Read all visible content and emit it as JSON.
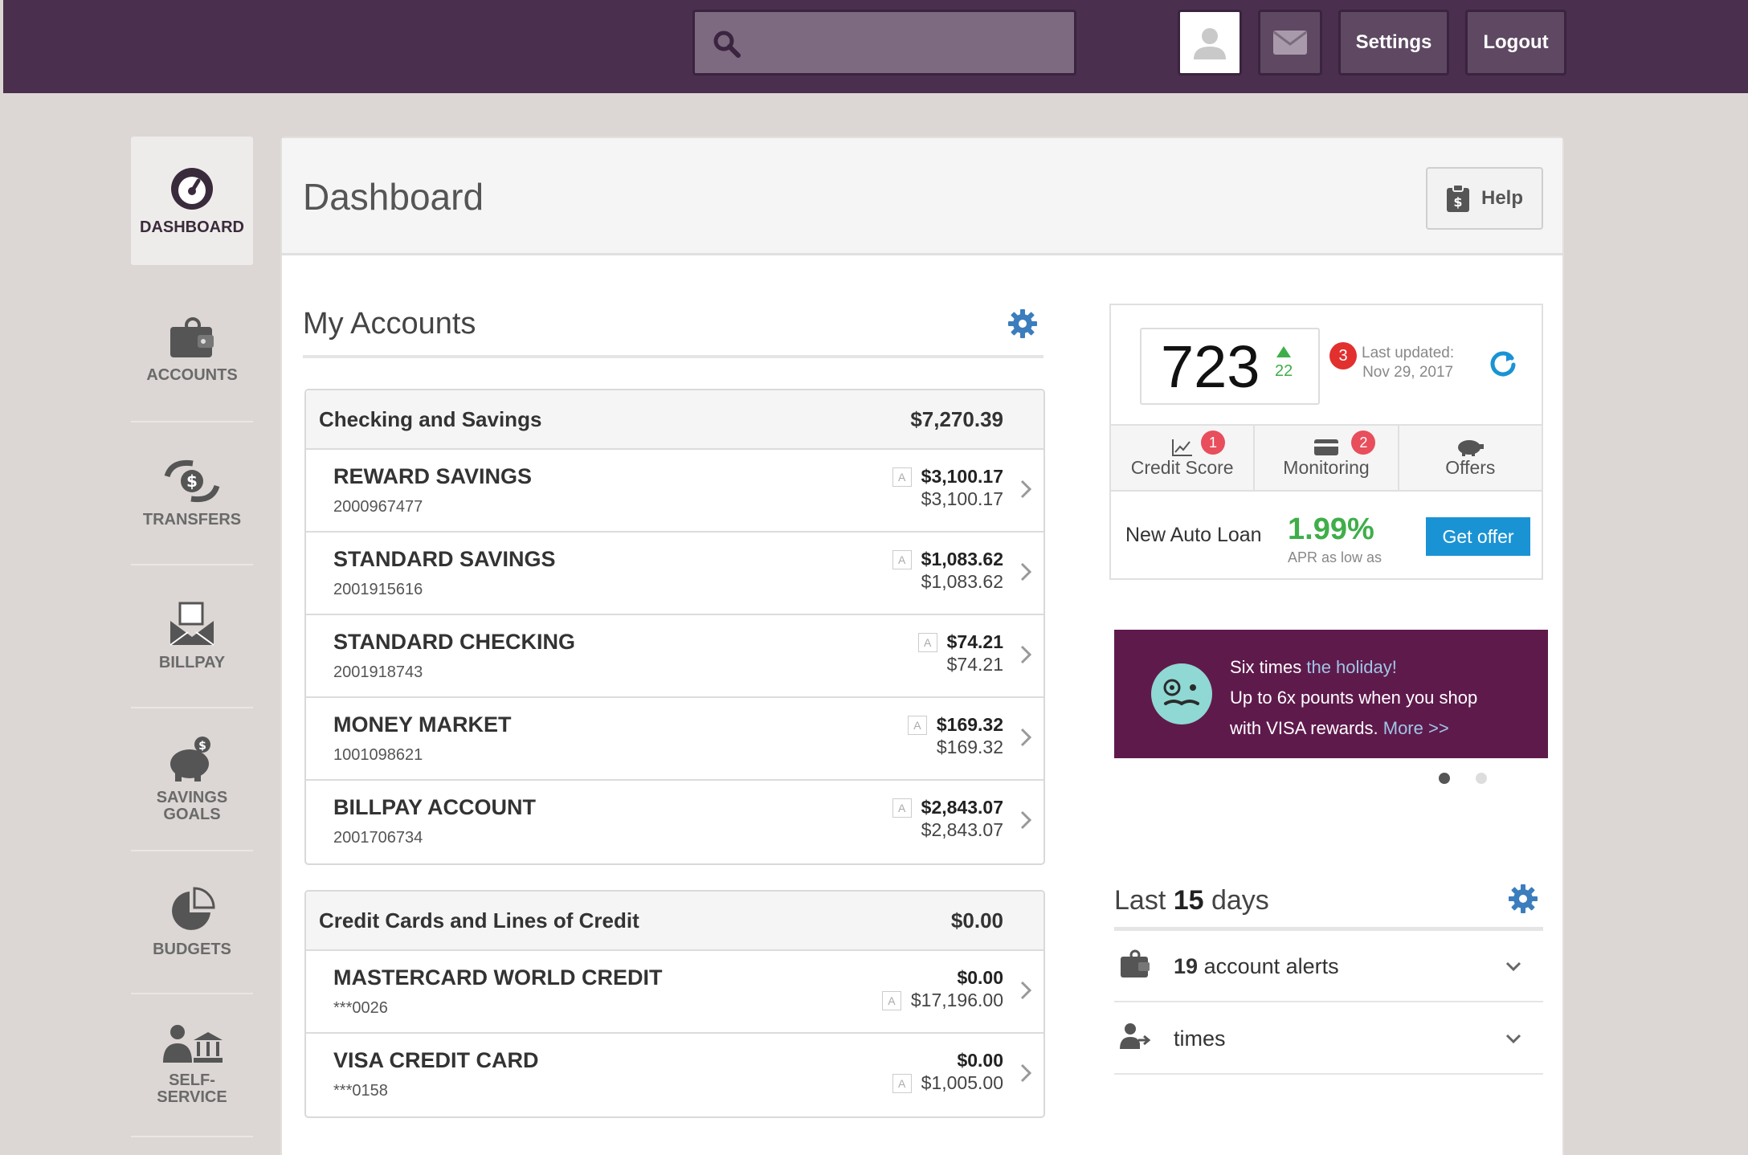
{
  "topbar": {
    "settings_label": "Settings",
    "logout_label": "Logout",
    "search_placeholder": ""
  },
  "sidebar": {
    "items": [
      {
        "label": "DASHBOARD"
      },
      {
        "label": "ACCOUNTS"
      },
      {
        "label": "TRANSFERS"
      },
      {
        "label": "BILLPAY"
      },
      {
        "label": "SAVINGS GOALS"
      },
      {
        "label": "BUDGETS"
      },
      {
        "label": "SELF-SERVICE"
      }
    ]
  },
  "header": {
    "title": "Dashboard",
    "help_label": "Help"
  },
  "accounts": {
    "title": "My Accounts",
    "groups": [
      {
        "name": "Checking and Savings",
        "total": "$7,270.39",
        "rows": [
          {
            "name": "REWARD SAVINGS",
            "number": "2000967477",
            "bal1": "$3,100.17",
            "bal2": "$3,100.17",
            "badge": "A"
          },
          {
            "name": "STANDARD SAVINGS",
            "number": "2001915616",
            "bal1": "$1,083.62",
            "bal2": "$1,083.62",
            "badge": "A"
          },
          {
            "name": "STANDARD CHECKING",
            "number": "2001918743",
            "bal1": "$74.21",
            "bal2": "$74.21",
            "badge": "A"
          },
          {
            "name": "MONEY MARKET",
            "number": "1001098621",
            "bal1": "$169.32",
            "bal2": "$169.32",
            "badge": "A"
          },
          {
            "name": "BILLPAY ACCOUNT",
            "number": "2001706734",
            "bal1": "$2,843.07",
            "bal2": "$2,843.07",
            "badge": "A"
          }
        ]
      },
      {
        "name": "Credit Cards and Lines of Credit",
        "total": "$0.00",
        "rows": [
          {
            "name": "MASTERCARD WORLD CREDIT",
            "number": "***0026",
            "bal1": "$0.00",
            "bal2": "$17,196.00",
            "badge": "A"
          },
          {
            "name": "VISA CREDIT CARD",
            "number": "***0158",
            "bal1": "$0.00",
            "bal2": "$1,005.00",
            "badge": "A"
          }
        ]
      }
    ]
  },
  "credit": {
    "score": "723",
    "delta": "22",
    "badge": "3",
    "updated_label": "Last updated:",
    "updated_date": "Nov 29, 2017",
    "tabs": [
      {
        "label": "Credit Score",
        "badge": "1"
      },
      {
        "label": "Monitoring",
        "badge": "2"
      },
      {
        "label": "Offers",
        "badge": ""
      }
    ],
    "offer": {
      "label": "New Auto Loan",
      "rate": "1.99%",
      "rate_sub": "APR as low as",
      "button": "Get offer"
    }
  },
  "promo": {
    "line1_a": "Six times ",
    "line1_b": "the holiday!",
    "line2": "Up to 6x pounts when you shop",
    "line3_a": "with VISA rewards. ",
    "line3_b": "More >>"
  },
  "last_days": {
    "title_a": "Last ",
    "title_num": "15",
    "title_b": " days",
    "rows": [
      {
        "count": "19",
        "label": "account alerts"
      },
      {
        "count": "",
        "label": "times"
      }
    ]
  },
  "colors": {
    "topbar": "#4b2f4f",
    "accent_blue": "#1a93d4",
    "green": "#3fae4a",
    "badge_red": "#e1302e",
    "promo_bg": "#5f1a4c"
  }
}
